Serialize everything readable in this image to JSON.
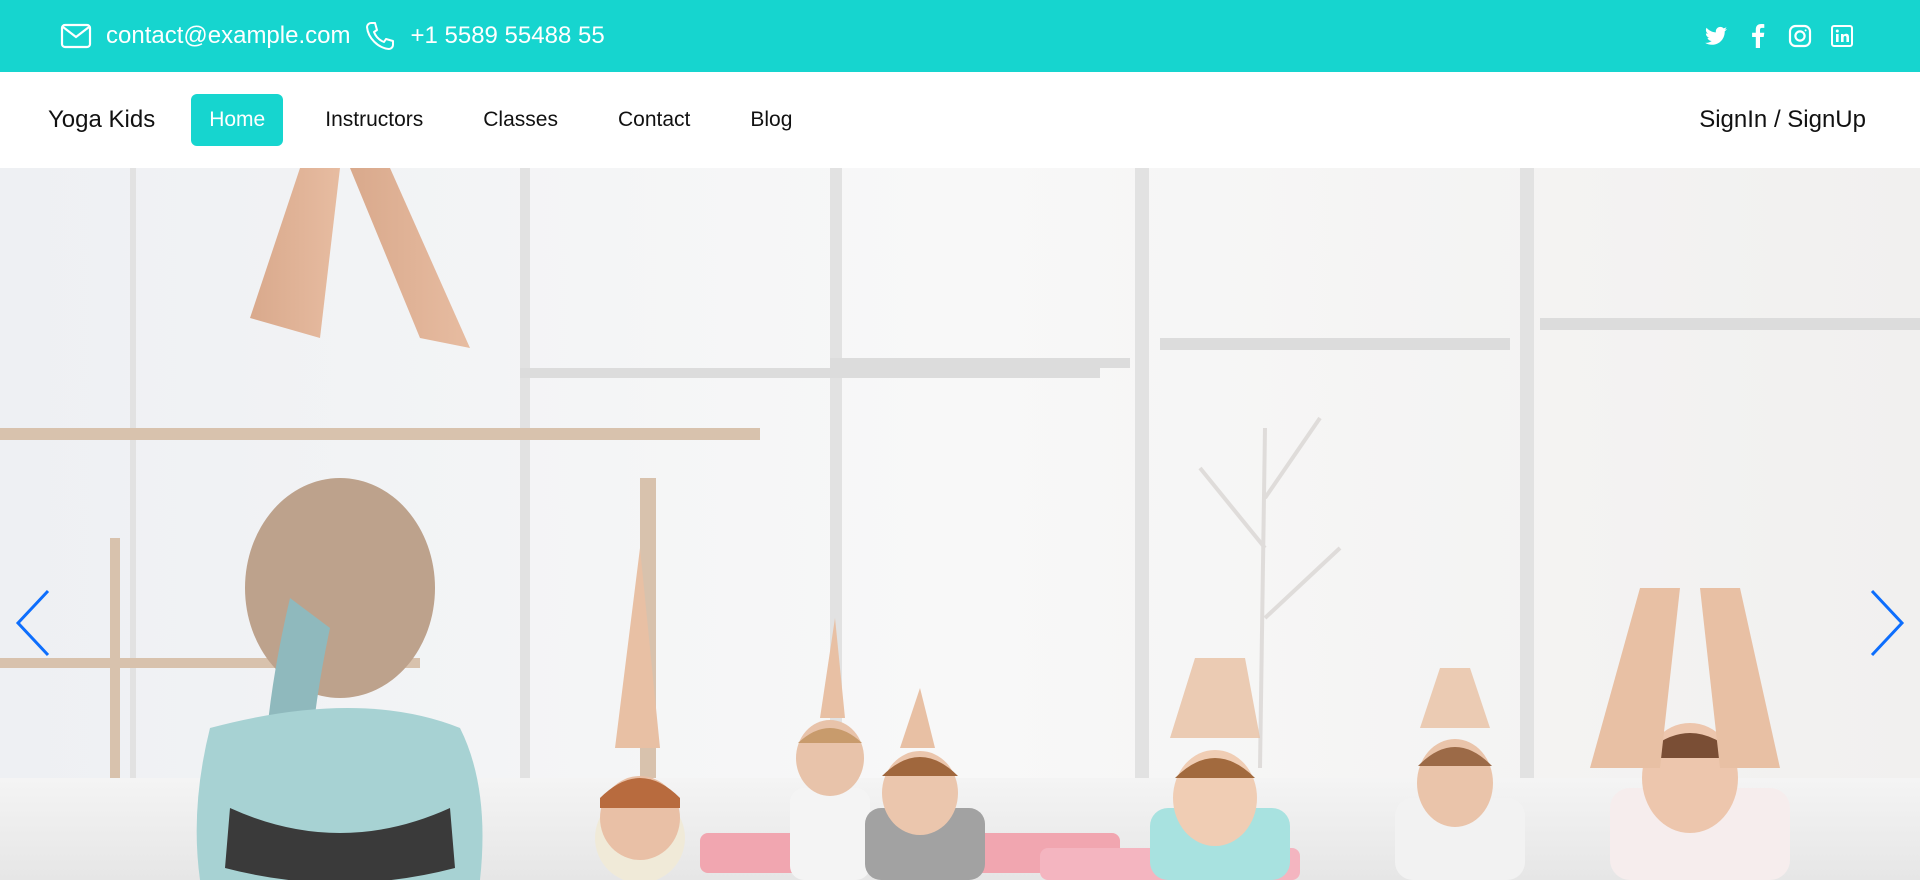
{
  "topbar": {
    "background": "#16d5cf",
    "email": "contact@example.com",
    "phone": "+1 5589 55488 55",
    "email_icon": "envelope-icon",
    "phone_icon": "phone-icon",
    "socials": [
      "twitter-icon",
      "facebook-icon",
      "instagram-icon",
      "linkedin-icon"
    ]
  },
  "navbar": {
    "brand": "Yoga Kids",
    "items": [
      {
        "label": "Home",
        "active": true
      },
      {
        "label": "Instructors",
        "active": false
      },
      {
        "label": "Classes",
        "active": false
      },
      {
        "label": "Contact",
        "active": false
      },
      {
        "label": "Blog",
        "active": false
      }
    ],
    "auth": "SignIn / SignUp",
    "accent": "#16d5cf"
  },
  "hero": {
    "image": "yoga-class-kids-photo",
    "controls": {
      "prev_icon": "chevron-left-icon",
      "next_icon": "chevron-right-icon",
      "color": "#0d6efd"
    }
  }
}
